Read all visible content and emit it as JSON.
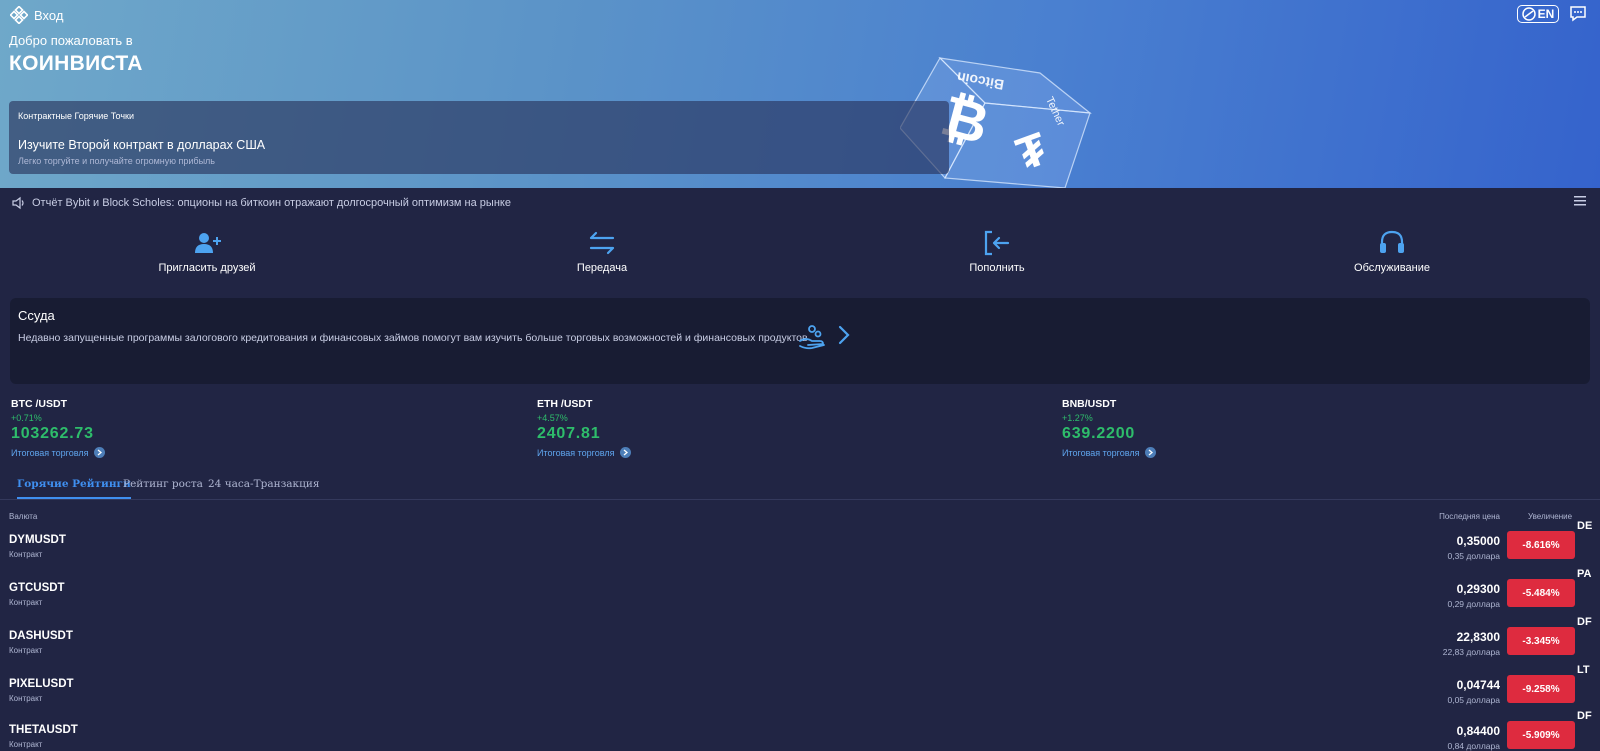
{
  "header": {
    "login_label": "Вход",
    "welcome": "Добро пожаловать в",
    "brand": "КОИНВИСТА",
    "lang": "EN"
  },
  "hero_card": {
    "label": "Контрактные Горячие Точки",
    "title": "Изучите Второй контракт в долларах США",
    "subtitle": "Легко торгуйте и получайте огромную прибыль"
  },
  "cube": {
    "top_text": "Bitcoin",
    "side_text": "Tether"
  },
  "news": {
    "text": "Отчёт Bybit и Block Scholes: опционы на биткоин отражают долгосрочный оптимизм на рынке"
  },
  "actions": [
    {
      "label": "Пригласить друзей",
      "icon": "invite-user-icon"
    },
    {
      "label": "Передача",
      "icon": "transfer-arrows-icon"
    },
    {
      "label": "Пополнить",
      "icon": "deposit-icon"
    },
    {
      "label": "Обслуживание",
      "icon": "headset-icon"
    }
  ],
  "loan": {
    "title": "Ссуда",
    "description": "Недавно запущенные программы залогового кредитования и финансовых займов помогут вам изучить больше торговых возможностей и финансовых продуктов"
  },
  "tickers": [
    {
      "pair": "BTC /USDT",
      "change": "+0.71%",
      "price": "103262.73",
      "summary": "Итоговая торговля"
    },
    {
      "pair": "ETH /USDT",
      "change": "+4.57%",
      "price": "2407.81",
      "summary": "Итоговая торговля"
    },
    {
      "pair": "BNB/USDT",
      "change": "+1.27%",
      "price": "639.2200",
      "summary": "Итоговая торговля"
    }
  ],
  "tabs": [
    {
      "label": "Горячие Рейтинги",
      "active": true
    },
    {
      "label": "Рейтинг роста",
      "active": false
    },
    {
      "label": "24 часа-Транзакция",
      "active": false
    }
  ],
  "table": {
    "col_currency": "Валюта",
    "col_last_price": "Последняя цена",
    "col_increase": "Увеличение",
    "rows": [
      {
        "symbol": "DYMUSDT",
        "type": "Контракт",
        "price": "0,35000",
        "usd": "0,35 доллара",
        "change": "-8.616%",
        "peek": "DE"
      },
      {
        "symbol": "GTCUSDT",
        "type": "Контракт",
        "price": "0,29300",
        "usd": "0,29 доллара",
        "change": "-5.484%",
        "peek": "PA"
      },
      {
        "symbol": "DASHUSDT",
        "type": "Контракт",
        "price": "22,8300",
        "usd": "22,83 доллара",
        "change": "-3.345%",
        "peek": "DF"
      },
      {
        "symbol": "PIXELUSDT",
        "type": "Контракт",
        "price": "0,04744",
        "usd": "0,05 доллара",
        "change": "-9.258%",
        "peek": "LT"
      },
      {
        "symbol": "THETAUSDT",
        "type": "Контракт",
        "price": "0,84400",
        "usd": "0,84 доллара",
        "change": "-5.909%",
        "peek": "DF"
      }
    ]
  },
  "colors": {
    "up": "#2ebd6b",
    "down": "#de2b3f",
    "accent": "#3f8ff0",
    "bg": "#212544"
  }
}
